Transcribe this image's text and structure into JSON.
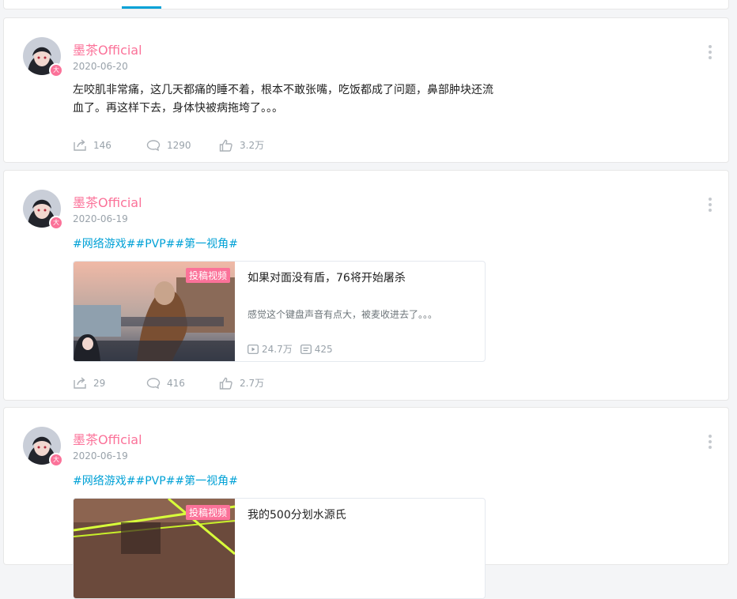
{
  "posts": [
    {
      "username": "墨茶Official",
      "date": "2020-06-20",
      "text": "左咬肌非常痛，这几天都痛的睡不着，根本不敢张嘴，吃饭都成了问题，鼻部肿块还流血了。再这样下去，身体快被病拖垮了。。。",
      "shares": "146",
      "comments": "1290",
      "likes": "3.2万"
    },
    {
      "username": "墨茶Official",
      "date": "2020-06-19",
      "tags": "#网络游戏##PVP##第一视角#",
      "video": {
        "label": "投稿视频",
        "title": "如果对面没有盾，76将开始屠杀",
        "desc": "感觉这个键盘声音有点大，被麦收进去了。。。",
        "plays": "24.7万",
        "danmaku": "425"
      },
      "shares": "29",
      "comments": "416",
      "likes": "2.7万"
    },
    {
      "username": "墨茶Official",
      "date": "2020-06-19",
      "tags": "#网络游戏##PVP##第一视角#",
      "video": {
        "label": "投稿视频",
        "title": "我的500分划水源氏"
      }
    }
  ],
  "colors": {
    "accent": "#00a1d6",
    "username": "#fb7299",
    "meta": "#99a2aa"
  },
  "icons": [
    "share-icon",
    "comment-icon",
    "like-icon",
    "more-icon",
    "play-icon",
    "danmaku-icon"
  ]
}
